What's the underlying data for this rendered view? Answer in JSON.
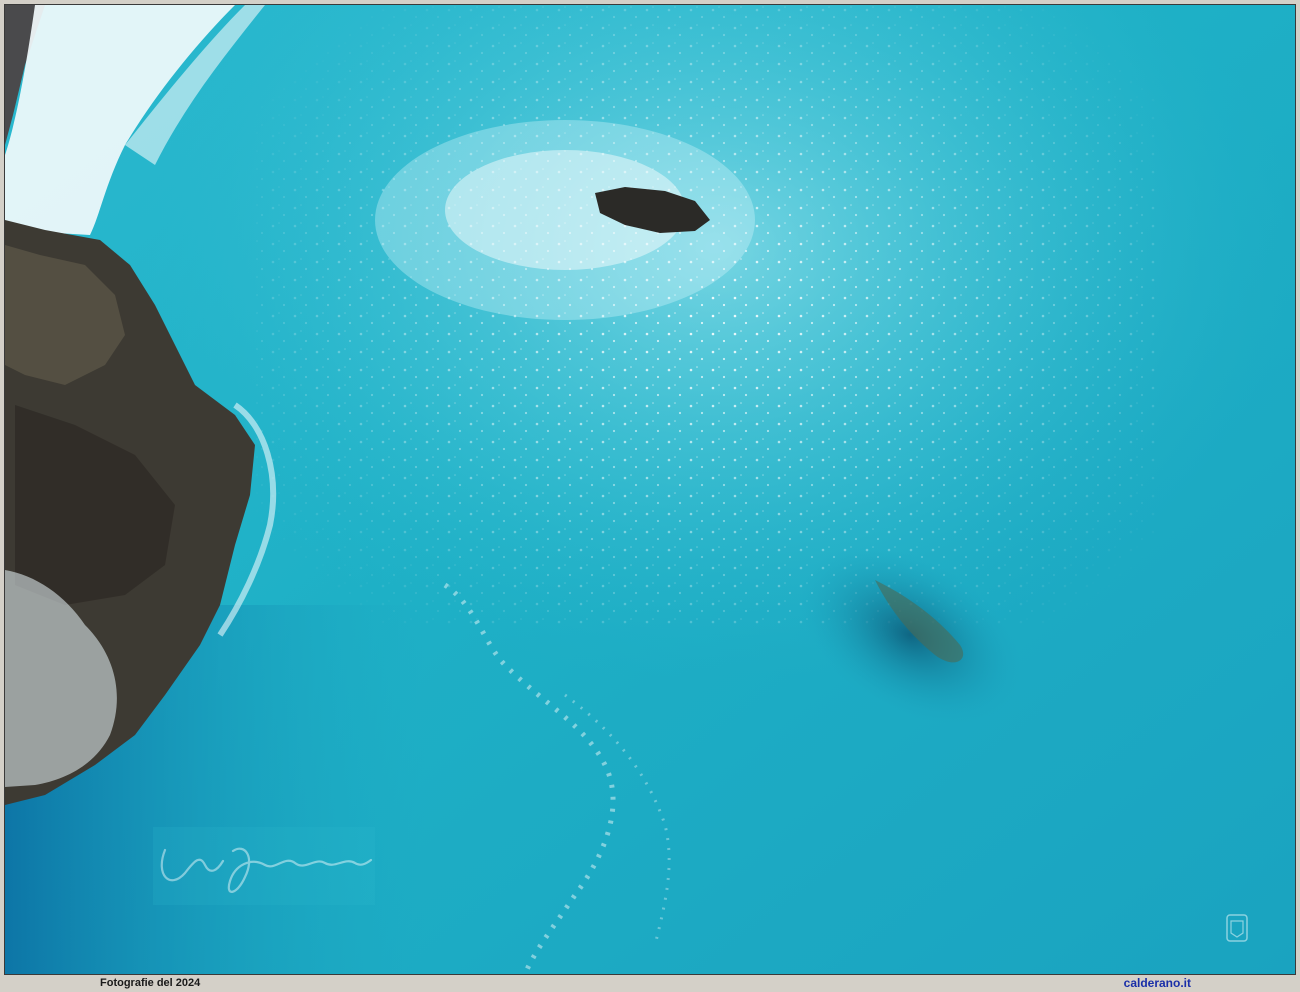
{
  "scene": {
    "description_colors": {
      "sea": "#20b4c8",
      "deep_sea": "#0f8fb2",
      "rock": "#3d3a33",
      "foam": "#f3fbfd"
    },
    "signature_text": "Pino Calderano"
  },
  "footer": {
    "left_text": "Fotografie del 2024",
    "right_text": "calderano.it",
    "right_color": "#1a2fa8"
  }
}
